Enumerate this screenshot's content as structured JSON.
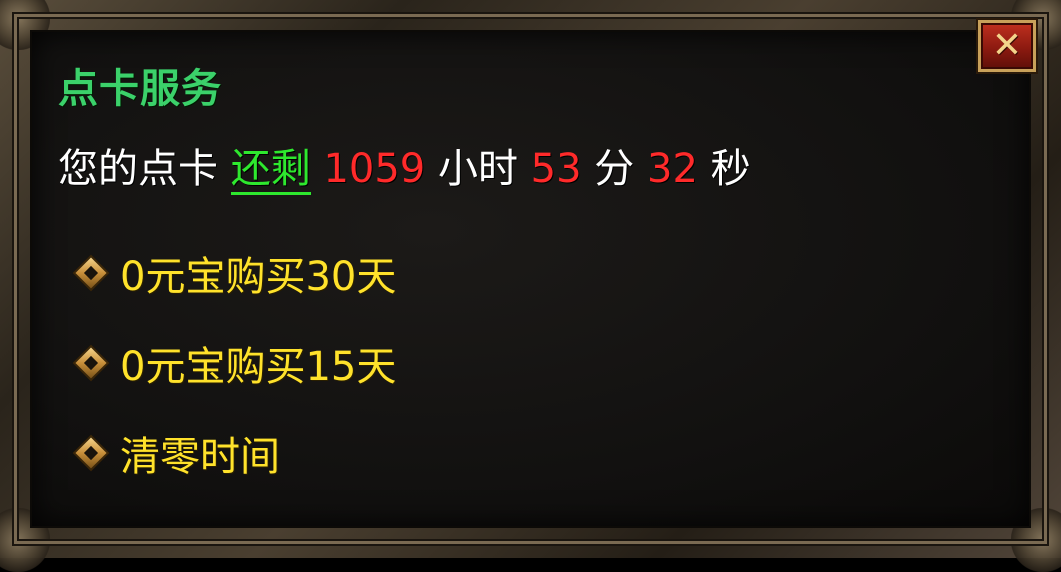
{
  "dialog": {
    "title": "点卡服务",
    "close_icon": "close-icon",
    "status": {
      "prefix": "您的点卡",
      "remain_label": "还剩",
      "hours": "1059",
      "hours_unit": "小时",
      "minutes": "53",
      "minutes_unit": "分",
      "seconds": "32",
      "seconds_unit": "秒"
    },
    "menu": [
      {
        "label": "0元宝购买30天",
        "icon": "diamond-bullet-icon"
      },
      {
        "label": "0元宝购买15天",
        "icon": "diamond-bullet-icon"
      },
      {
        "label": "清零时间",
        "icon": "diamond-bullet-icon"
      }
    ],
    "colors": {
      "title": "#3bd16a",
      "remain": "#2ee82e",
      "numbers": "#ff2a2a",
      "menu_text": "#ffe22b",
      "close_bg": "#8c1a10"
    }
  }
}
